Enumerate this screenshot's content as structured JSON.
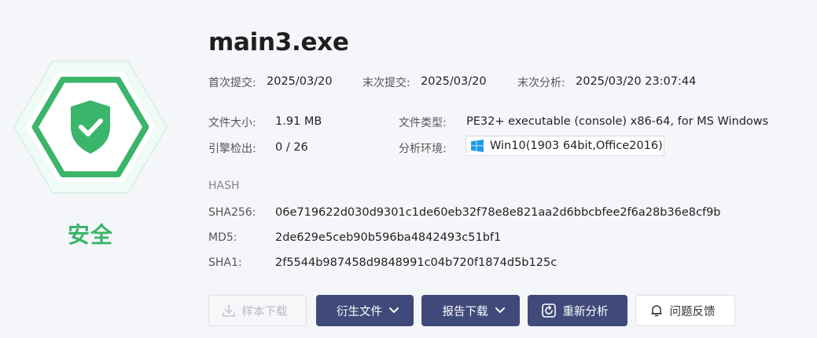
{
  "file": {
    "name": "main3.exe",
    "status": "安全"
  },
  "dates": {
    "first_submit_label": "首次提交:",
    "first_submit_value": "2025/03/20",
    "last_submit_label": "末次提交:",
    "last_submit_value": "2025/03/20",
    "last_analysis_label": "末次分析:",
    "last_analysis_value": "2025/03/20 23:07:44"
  },
  "details": {
    "size_label": "文件大小:",
    "size_value": "1.91 MB",
    "type_label": "文件类型:",
    "type_value": "PE32+ executable (console) x86-64, for MS Windows",
    "engines_label": "引擎检出:",
    "engines_value": "0 / 26",
    "env_label": "分析环境:",
    "env_value": "Win10(1903 64bit,Office2016)",
    "env_icon": "windows-logo-icon"
  },
  "hash": {
    "heading": "HASH",
    "sha256_label": "SHA256:",
    "sha256_value": "06e719622d030d9301c1de60eb32f78e8e821aa2d6bbcbfee2f6a28b36e8cf9b",
    "md5_label": "MD5:",
    "md5_value": "2de629e5ceb90b596ba4842493c51bf1",
    "sha1_label": "SHA1:",
    "sha1_value": "2f5544b987458d9848991c04b720f1874d5b125c"
  },
  "actions": {
    "sample_download": "样本下载",
    "derived_files": "衍生文件",
    "report_download": "报告下载",
    "reanalyze": "重新分析",
    "feedback": "问题反馈"
  },
  "colors": {
    "safe_green": "#3bb56a",
    "button_primary": "#404a7a",
    "background": "#f5f6fa"
  }
}
